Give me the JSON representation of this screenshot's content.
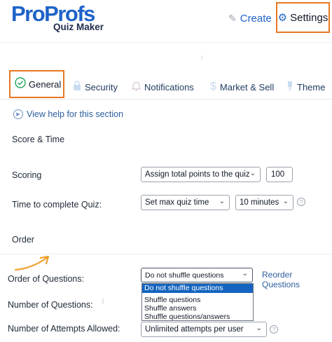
{
  "brand": {
    "name": "ProProfs",
    "product": "Quiz Maker"
  },
  "header": {
    "create_label": "Create",
    "settings_label": "Settings"
  },
  "tabs": [
    {
      "label": "General",
      "icon": "check-circle-icon",
      "active": true
    },
    {
      "label": "Security",
      "icon": "lock-icon"
    },
    {
      "label": "Notifications",
      "icon": "bell-icon"
    },
    {
      "label": "Market & Sell",
      "icon": "dollar-icon"
    },
    {
      "label": "Theme",
      "icon": "brush-icon"
    }
  ],
  "help_link": "View help for this section",
  "score_time": {
    "title": "Score & Time",
    "scoring_label": "Scoring",
    "scoring_value": "Assign total points to the quiz",
    "scoring_points": "100",
    "time_label": "Time to complete Quiz:",
    "time_mode": "Set max quiz time",
    "time_amount": "10 minutes"
  },
  "order": {
    "title": "Order",
    "order_label": "Order of Questions:",
    "order_value": "Do not shuffle questions",
    "order_options": [
      "Do not shuffle questions",
      "Shuffle questions",
      "Shuffle answers",
      "Shuffle questions/answers"
    ],
    "reorder_link": "Reorder Questions",
    "number_label": "Number of Questions:",
    "attempts_label": "Number of Attempts Allowed:",
    "attempts_value": "Unlimited attempts per user"
  },
  "colors": {
    "highlight": "#e87722",
    "link": "#2e5e9e",
    "brand": "#1e63c8",
    "selected_option": "#1565c0",
    "arrow": "#f0a030"
  }
}
